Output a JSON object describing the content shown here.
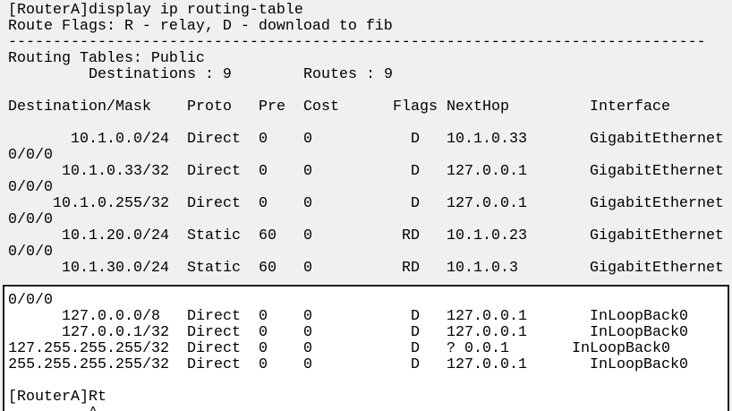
{
  "theme": {
    "background": "#f0f0f0",
    "panel": "#ffffff",
    "text": "#000000",
    "border": "#1c1c1c"
  },
  "terminal": {
    "command_echo": "[RouterA]display ip routing-table",
    "route_flags": "Route Flags: R - relay, D - download to fib",
    "separator": "------------------------------------------------------------------------------",
    "routing_tables": "Routing Tables: Public",
    "summary": {
      "destinations": "Destinations : 9",
      "routes": "Routes : 9"
    },
    "columns": [
      "Destination/Mask",
      "Proto",
      "Pre",
      "Cost",
      "Flags",
      "NextHop",
      "Interface"
    ],
    "routes": [
      {
        "destination": "10.1.0.0/24",
        "proto": "Direct",
        "pre": "0",
        "cost": "0",
        "flags": "D",
        "nexthop": "10.1.0.33",
        "interface": [
          "GigabitEthernet",
          "0/0/0"
        ]
      },
      {
        "destination": "10.1.0.33/32",
        "proto": "Direct",
        "pre": "0",
        "cost": "0",
        "flags": "D",
        "nexthop": "127.0.0.1",
        "interface": [
          "GigabitEthernet",
          "0/0/0"
        ]
      },
      {
        "destination": "10.1.0.255/32",
        "proto": "Direct",
        "pre": "0",
        "cost": "0",
        "flags": "D",
        "nexthop": "127.0.0.1",
        "interface": [
          "GigabitEthernet",
          "0/0/0"
        ]
      },
      {
        "destination": "10.1.20.0/24",
        "proto": "Static",
        "pre": "60",
        "cost": "0",
        "flags": "RD",
        "nexthop": "10.1.0.23",
        "interface": [
          "GigabitEthernet",
          "0/0/0"
        ]
      },
      {
        "destination": "10.1.30.0/24",
        "proto": "Static",
        "pre": "60",
        "cost": "0",
        "flags": "RD",
        "nexthop": "10.1.0.3",
        "interface": [
          "GigabitEthernet",
          "0/0/0"
        ]
      },
      {
        "destination": "127.0.0.0/8",
        "proto": "Direct",
        "pre": "0",
        "cost": "0",
        "flags": "D",
        "nexthop": "127.0.0.1",
        "interface": [
          "InLoopBack0"
        ]
      },
      {
        "destination": "127.0.0.1/32",
        "proto": "Direct",
        "pre": "0",
        "cost": "0",
        "flags": "D",
        "nexthop": "127.0.0.1",
        "interface": [
          "InLoopBack0"
        ]
      },
      {
        "destination": "127.255.255.255/32",
        "proto": "Direct",
        "pre": "0",
        "cost": "0",
        "flags": "D",
        "nexthop": "? 0.0.1",
        "interface": [
          "InLoopBack0"
        ]
      },
      {
        "destination": "255.255.255.255/32",
        "proto": "Direct",
        "pre": "0",
        "cost": "0",
        "flags": "D",
        "nexthop": "127.0.0.1",
        "interface": [
          "InLoopBack0"
        ]
      }
    ],
    "input_line": "[RouterA]Rt",
    "error_marker": "^"
  }
}
